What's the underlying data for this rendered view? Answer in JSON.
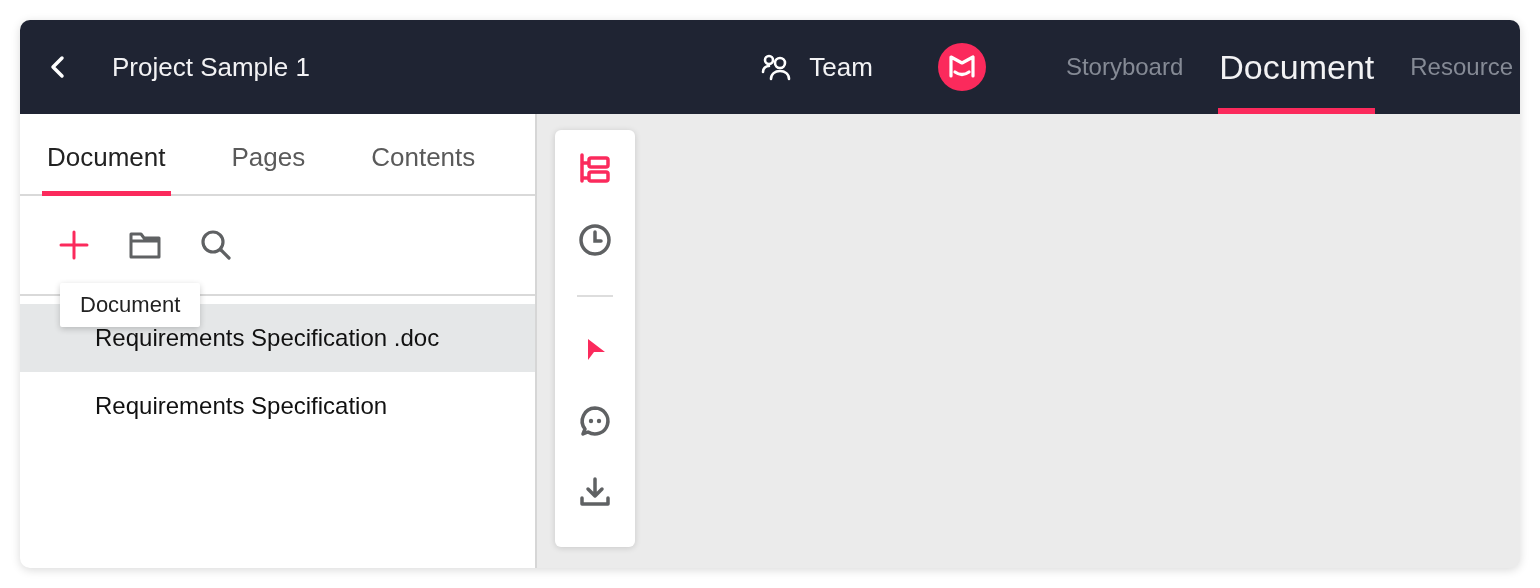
{
  "header": {
    "title": "Project Sample 1",
    "team": "Team",
    "nav": [
      {
        "label": "Storyboard",
        "selected": false
      },
      {
        "label": "Document",
        "selected": true
      },
      {
        "label": "Resource",
        "selected": false
      }
    ]
  },
  "panel": {
    "tabs": [
      {
        "label": "Document",
        "selected": true
      },
      {
        "label": "Pages",
        "selected": false
      },
      {
        "label": "Contents",
        "selected": false
      }
    ],
    "tooltip": "Document",
    "items": [
      {
        "label": "Requirements Specification .doc",
        "selected": true
      },
      {
        "label": "Requirements Specification",
        "selected": false
      }
    ]
  },
  "side_tools": [
    {
      "kind": "outline",
      "selected": true
    },
    {
      "kind": "history",
      "selected": false
    },
    {
      "kind": "divider"
    },
    {
      "kind": "pointer",
      "selected": true
    },
    {
      "kind": "comment",
      "selected": false
    },
    {
      "kind": "download",
      "selected": false
    }
  ]
}
